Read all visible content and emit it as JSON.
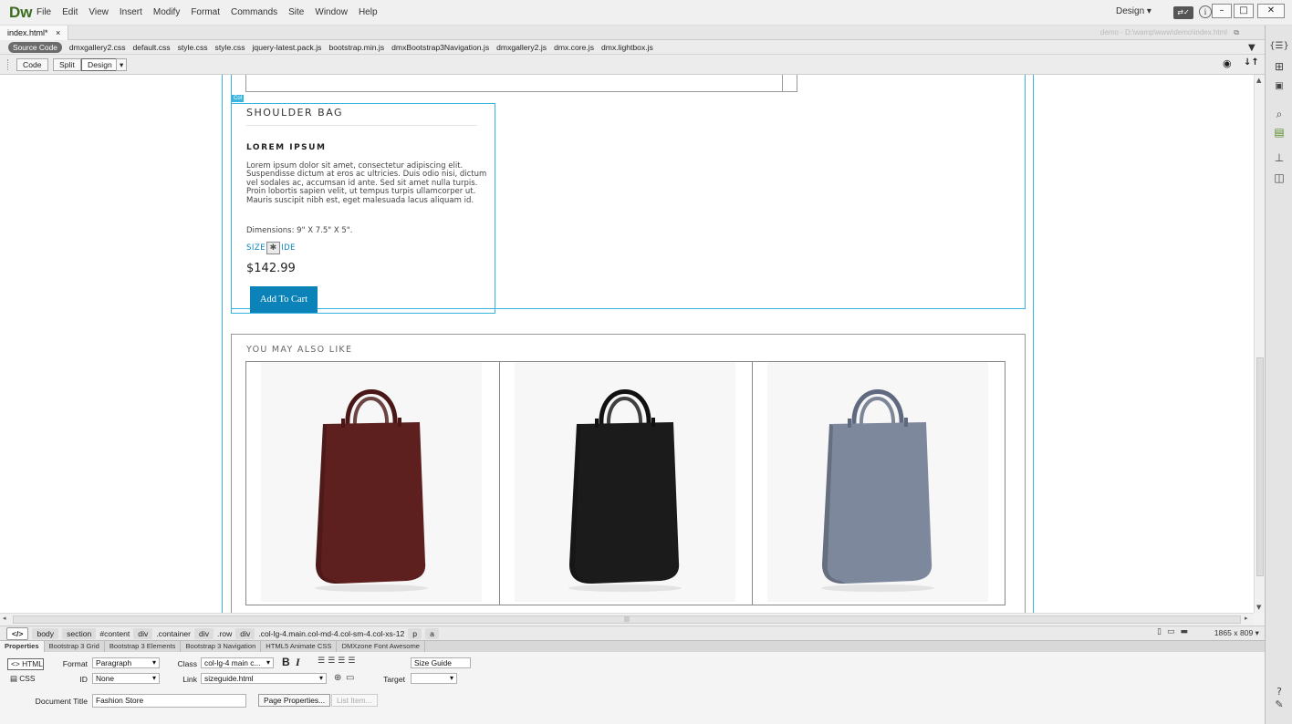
{
  "app": {
    "logo": "Dw",
    "menus": [
      "File",
      "Edit",
      "View",
      "Insert",
      "Modify",
      "Format",
      "Commands",
      "Site",
      "Window",
      "Help"
    ],
    "workspace": "Design ▾",
    "window_controls": [
      "–",
      "□",
      "✕"
    ]
  },
  "tabs": {
    "doc_tab": "index.html*",
    "close": "×",
    "doc_path": "demo - D:\\wamp\\www\\demo\\index.html"
  },
  "related_files": {
    "source": "Source Code",
    "files": [
      "dmxgallery2.css",
      "default.css",
      "style.css",
      "style.css",
      "jquery-latest.pack.js",
      "bootstrap.min.js",
      "dmxBootstrap3Navigation.js",
      "dmxgallery2.js",
      "dmx.core.js",
      "dmx.lightbox.js"
    ]
  },
  "doc_toolbar": {
    "code": "Code",
    "split": "Split",
    "design": "Design"
  },
  "canvas": {
    "col_badge": "Col",
    "product": {
      "name": "SHOULDER BAG",
      "subheading": "LOREM IPSUM",
      "description": "Lorem ipsum dolor sit amet, consectetur adipiscing elit. Suspendisse dictum at eros ac ultricies. Duis odio nisi, dictum vel sodales ac, accumsan id ante. Sed sit amet nulla turpis. Proin lobortis sapien velit, ut tempus turpis ullamcorper ut. Mauris suscipit nibh est, eget malesuada lacus aliquam id.",
      "dimensions": "Dimensions: 9\" X 7.5\" X 5\".",
      "size_guide_a": "SIZE",
      "size_guide_b": "IDE",
      "price": "$142.99",
      "cart_button": "Add To Cart"
    },
    "related": {
      "heading": "YOU MAY ALSO LIKE",
      "items": [
        {
          "color": "#5e1f1f",
          "handle": "#4a1717",
          "name": "burgundy-bag"
        },
        {
          "color": "#1b1b1b",
          "handle": "#111111",
          "name": "black-bag"
        },
        {
          "color": "#7d889c",
          "handle": "#5f6a80",
          "name": "grey-blue-bag"
        }
      ]
    }
  },
  "tag_selector": {
    "code_tag": "</>",
    "tags": [
      "body",
      "section",
      "#content",
      "div",
      ".container",
      "div",
      ".row",
      "div",
      ".col-lg-4.main.col-md-4.col-sm-4.col-xs-12",
      "p",
      "a"
    ],
    "screen_size": "1865 x 809 ▾"
  },
  "properties": {
    "tabs": [
      "Properties",
      "Bootstrap 3 Grid",
      "Bootstrap 3 Elements",
      "Bootstrap 3 Navigation",
      "HTML5 Animate CSS",
      "DMXzone Font Awesome"
    ],
    "html_mode": "<> HTML",
    "css_mode": "CSS",
    "format_label": "Format",
    "format_value": "Paragraph",
    "id_label": "ID",
    "id_value": "None",
    "class_label": "Class",
    "class_value": "col-lg-4 main c...",
    "link_label": "Link",
    "link_value": "sizeguide.html",
    "title_label": "Title",
    "title_value": "Size Guide",
    "target_label": "Target",
    "target_value": "",
    "doc_title_label": "Document Title",
    "doc_title_value": "Fashion Store",
    "page_props": "Page Properties...",
    "list_item": "List Item..."
  },
  "colors": {
    "accent": "#0b83b8",
    "guide": "#38b4e0",
    "chrome": "#ececec"
  }
}
